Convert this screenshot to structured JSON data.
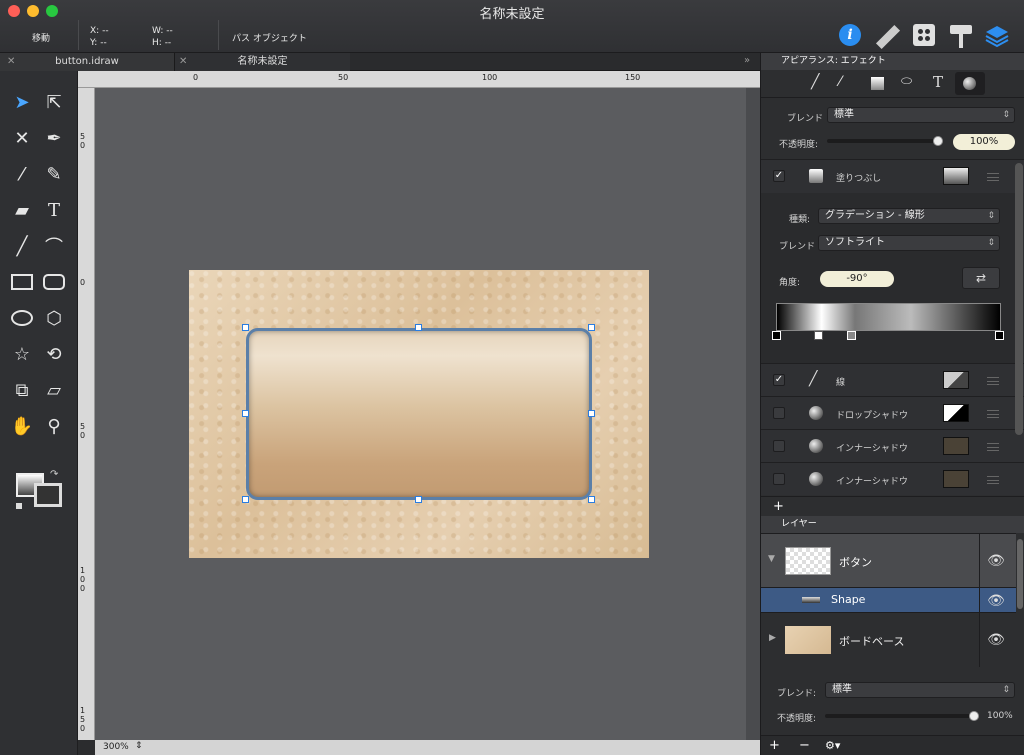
{
  "window": {
    "title": "名称未設定"
  },
  "toolbar": {
    "mode": "移動",
    "x_label": "X:",
    "x_val": "--",
    "y_label": "Y:",
    "y_val": "--",
    "w_label": "W:",
    "w_val": "--",
    "h_label": "H:",
    "h_val": "--",
    "selection": "パス オブジェクト",
    "icons": [
      "info-icon",
      "ruler-icon",
      "grid-icon",
      "paint-roller-icon",
      "layers-icon"
    ]
  },
  "tabs": [
    {
      "label": "button.idraw"
    },
    {
      "label": "名称未設定"
    }
  ],
  "rulers": {
    "h": [
      "0",
      "50",
      "100",
      "150"
    ],
    "v": [
      "50",
      "0",
      "50",
      "100",
      "150"
    ]
  },
  "status": {
    "zoom": "300%"
  },
  "appearance": {
    "header": "アピアランス: エフェクト",
    "blend_label": "ブレンド",
    "blend_value": "標準",
    "opacity_label": "不透明度:",
    "opacity_value": "100%",
    "opacity_level": 1.0,
    "fill": {
      "label": "塗りつぶし",
      "checked": true
    },
    "type_label": "種類:",
    "type_value": "グラデーション - 線形",
    "fill_blend_label": "ブレンド",
    "fill_blend_value": "ソフトライト",
    "angle_label": "角度:",
    "angle_value": "-90°",
    "stroke": {
      "label": "線",
      "checked": true
    },
    "effects": [
      {
        "label": "ドロップシャドウ",
        "checked": false
      },
      {
        "label": "インナーシャドウ",
        "checked": false
      },
      {
        "label": "インナーシャドウ",
        "checked": false
      }
    ],
    "add": "+"
  },
  "layers": {
    "header": "レイヤー",
    "items": [
      {
        "name": "ボタン"
      },
      {
        "name": "Shape"
      },
      {
        "name": "ボードベース"
      }
    ],
    "blend_label": "ブレンド:",
    "blend_value": "標準",
    "opacity_label": "不透明度:",
    "opacity_value": "100%",
    "opacity_level": 1.0,
    "add": "+",
    "remove": "−",
    "gear": "⚙▾"
  }
}
